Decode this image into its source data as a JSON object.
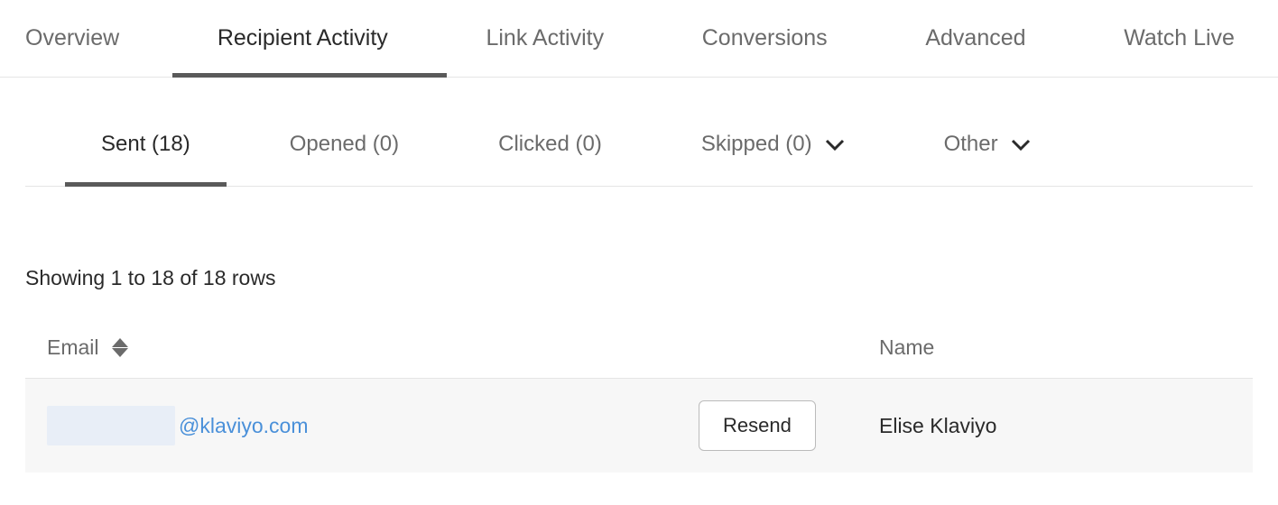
{
  "mainTabs": {
    "overview": "Overview",
    "recipientActivity": "Recipient Activity",
    "linkActivity": "Link Activity",
    "conversions": "Conversions",
    "advanced": "Advanced",
    "watchLive": "Watch Live"
  },
  "subTabs": {
    "sent": "Sent (18)",
    "opened": "Opened (0)",
    "clicked": "Clicked (0)",
    "skipped": "Skipped (0)",
    "other": "Other"
  },
  "showingText": "Showing 1 to 18 of 18 rows",
  "tableHeaders": {
    "email": "Email",
    "name": "Name"
  },
  "rows": [
    {
      "emailDomain": "@klaviyo.com",
      "resendLabel": "Resend",
      "name": "Elise Klaviyo"
    }
  ]
}
